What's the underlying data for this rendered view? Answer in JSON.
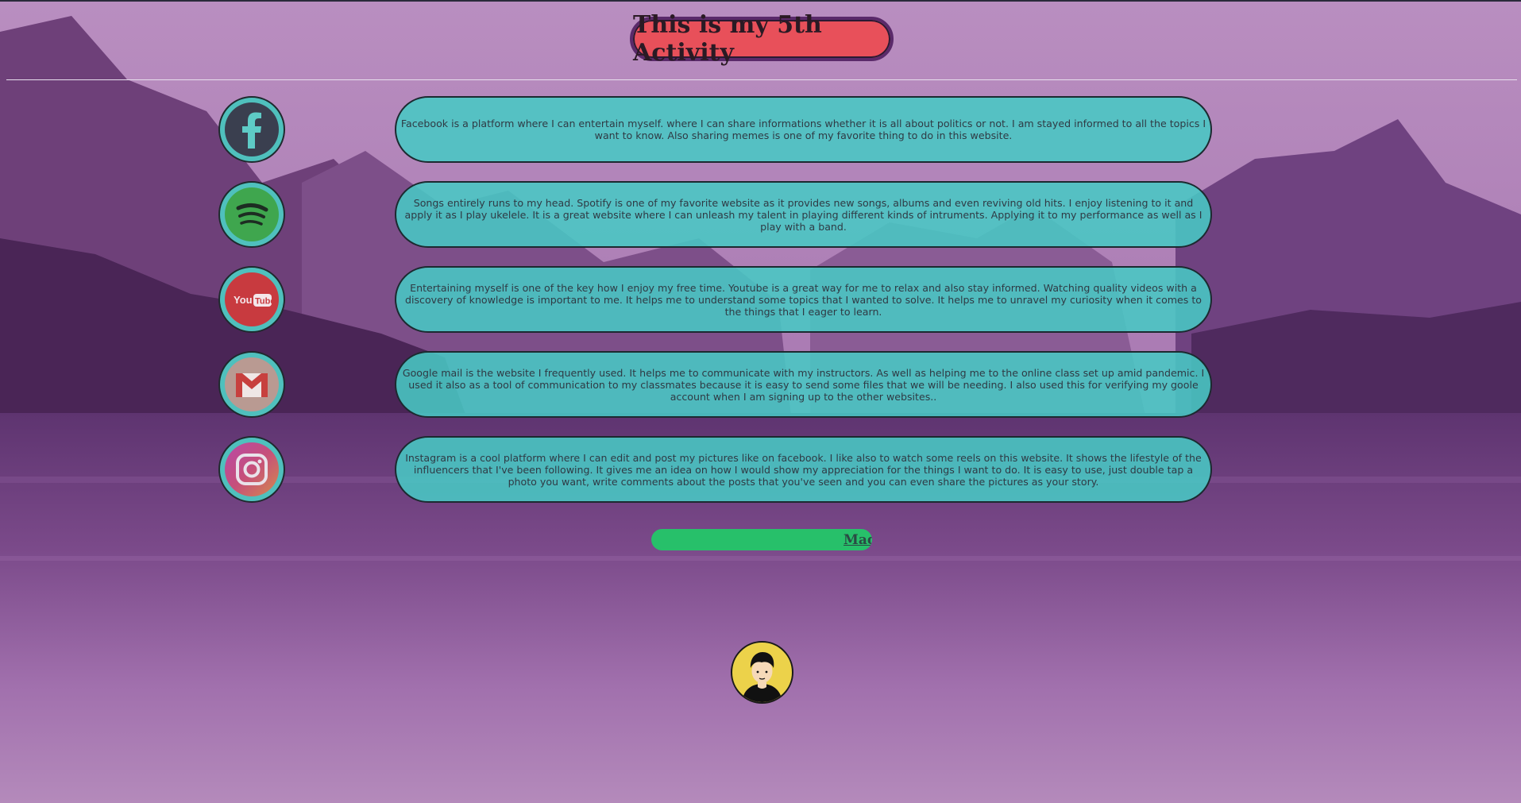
{
  "title": "This is my 5th Activity",
  "items": [
    {
      "icon": "facebook-icon",
      "text": "Facebook is a platform where I can entertain myself. where I can share informations whether it is all about politics or not. I am stayed informed to all the topics I want to know. Also sharing memes is one of my favorite thing to do in this website."
    },
    {
      "icon": "spotify-icon",
      "text": "Songs entirely runs to my head. Spotify is one of my favorite website as it provides new songs, albums and even reviving old hits. I enjoy listening to it and apply it as I play ukelele. It is a great website where I can unleash my talent in playing different kinds of intruments. Applying it to my performance as well as I play with a band."
    },
    {
      "icon": "youtube-icon",
      "icon_label": "You Tube",
      "text": "Entertaining myself is one of the key how I enjoy my free time. Youtube is a great way for me to relax and also stay informed. Watching quality videos with a discovery of knowledge is important to me. It helps me to understand some topics that I wanted to solve. It helps me to unravel my curiosity when it comes to the things that I eager to learn."
    },
    {
      "icon": "gmail-icon",
      "text": "Google mail is the website I frequently used. It helps me to communicate with my instructors. As well as helping me to the online class set up amid pandemic. I used it also as a tool of communication to my classmates because it is easy to send some files that we will be needing. I also used this for verifying my goole account when I am signing up to the other websites.."
    },
    {
      "icon": "instagram-icon",
      "text": "Instagram is a cool platform where I can edit and post my pictures like on facebook. I like also to watch some reels on this website. It shows the lifestyle of the influencers that I've been following. It gives me an idea on how I would show my appreciation for the things I want to do. It is easy to use, just double tap a photo you want, write comments about the posts that you've seen and you can even share the pictures as your story."
    }
  ],
  "marquee": "Mad",
  "avatar": "avatar-icon",
  "colors": {
    "title_bg": "#e8505a",
    "card_bg": "#48c8c4",
    "marquee_bg": "#27c06a",
    "avatar_bg": "#ecd24a"
  }
}
